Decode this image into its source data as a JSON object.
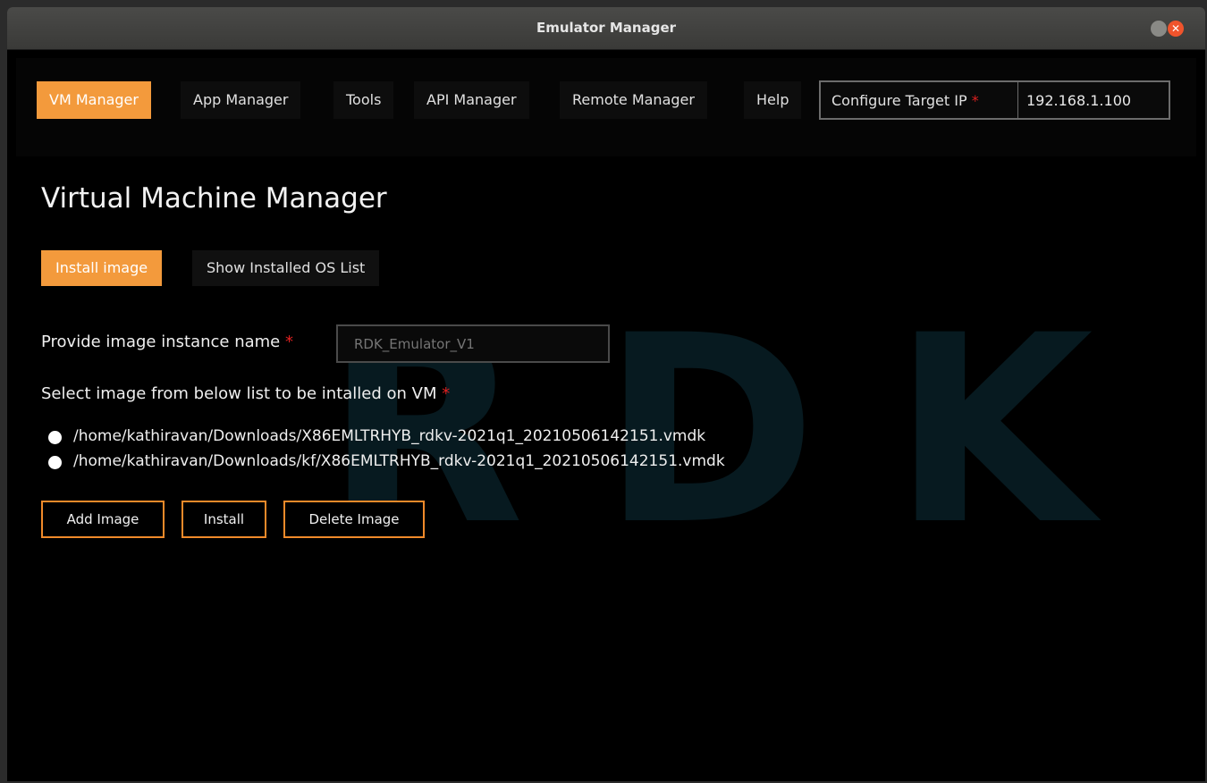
{
  "window": {
    "title": "Emulator Manager"
  },
  "nav": {
    "items": [
      {
        "label": "VM Manager",
        "active": true
      },
      {
        "label": "App Manager",
        "active": false
      },
      {
        "label": "Tools",
        "active": false
      },
      {
        "label": "API Manager",
        "active": false
      },
      {
        "label": "Remote Manager",
        "active": false
      },
      {
        "label": "Help",
        "active": false
      }
    ],
    "target": {
      "label": "Configure Target IP",
      "required_mark": "*",
      "value": "192.168.1.100"
    }
  },
  "watermark": {
    "letters": [
      "R",
      "D",
      "K"
    ]
  },
  "main": {
    "title": "Virtual Machine Manager",
    "tabs": [
      {
        "label": "Install image",
        "active": true
      },
      {
        "label": "Show Installed OS List",
        "active": false
      }
    ],
    "instance_name": {
      "label": "Provide image instance name",
      "required_mark": "*",
      "placeholder": "RDK_Emulator_V1"
    },
    "image_select": {
      "label": "Select image from below list to be intalled on VM",
      "required_mark": "*",
      "options": [
        "/home/kathiravan/Downloads/X86EMLTRHYB_rdkv-2021q1_20210506142151.vmdk",
        "/home/kathiravan/Downloads/kf/X86EMLTRHYB_rdkv-2021q1_20210506142151.vmdk"
      ]
    },
    "actions": {
      "add": "Add Image",
      "install": "Install",
      "delete": "Delete Image"
    }
  },
  "colors": {
    "accent": "#f39a3c",
    "border_accent": "#f08a2a",
    "required": "#e02020",
    "background": "#000000"
  }
}
